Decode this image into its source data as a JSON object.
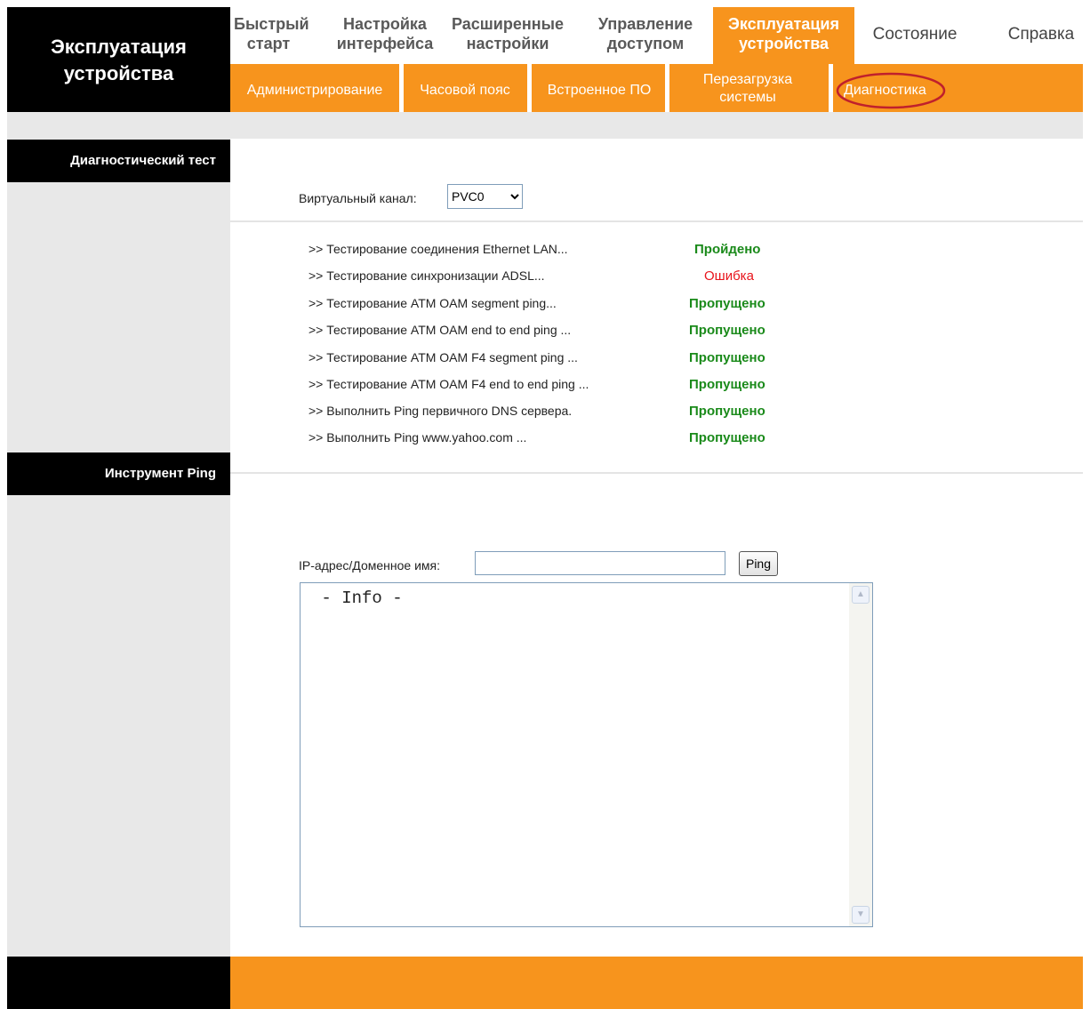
{
  "brand": {
    "line1": "Эксплуатация",
    "line2": "устройства"
  },
  "topnav": {
    "quick": {
      "l1": "Быстрый",
      "l2": "старт"
    },
    "iface": {
      "l1": "Настройка",
      "l2": "интерфейса"
    },
    "adv": {
      "l1": "Расширенные",
      "l2": "настройки"
    },
    "access": {
      "l1": "Управление",
      "l2": "доступом"
    },
    "maint": {
      "l1": "Эксплуатация",
      "l2": "устройства"
    },
    "status": "Состояние",
    "help": "Справка"
  },
  "subnav": {
    "admin": "Администрирование",
    "tz": "Часовой пояс",
    "fw": "Встроенное ПО",
    "reboot": {
      "l1": "Перезагрузка",
      "l2": "системы"
    },
    "diag": "Диагностика"
  },
  "sections": {
    "diag_test": "Диагностический тест",
    "ping_tool": "Инструмент Ping"
  },
  "vc": {
    "label": "Виртуальный канал:",
    "selected": "PVC0"
  },
  "tests": [
    {
      "label": ">> Тестирование соединения Ethernet LAN...",
      "result": "Пройдено",
      "status": "pass"
    },
    {
      "label": ">> Тестирование синхронизации ADSL...",
      "result": "Ошибка",
      "status": "fail"
    },
    {
      "label": ">> Тестирование ATM OAM segment ping...",
      "result": "Пропущено",
      "status": "skip"
    },
    {
      "label": ">> Тестирование ATM OAM end to end ping ...",
      "result": "Пропущено",
      "status": "skip"
    },
    {
      "label": ">> Тестирование ATM OAM F4 segment ping ...",
      "result": "Пропущено",
      "status": "skip"
    },
    {
      "label": ">> Тестирование ATM OAM F4 end to end ping ...",
      "result": "Пропущено",
      "status": "skip"
    },
    {
      "label": ">> Выполнить Ping первичного DNS сервера.",
      "result": "Пропущено",
      "status": "skip"
    },
    {
      "label": ">> Выполнить Ping www.yahoo.com ...",
      "result": "Пропущено",
      "status": "skip"
    }
  ],
  "ping": {
    "label": "IP-адрес/Доменное имя:",
    "value": "",
    "button": "Ping",
    "info": " - Info -"
  },
  "colors": {
    "accent": "#f7941d",
    "pass": "#1a8a1a",
    "fail": "#e8141c",
    "highlight": "#c0202c"
  }
}
